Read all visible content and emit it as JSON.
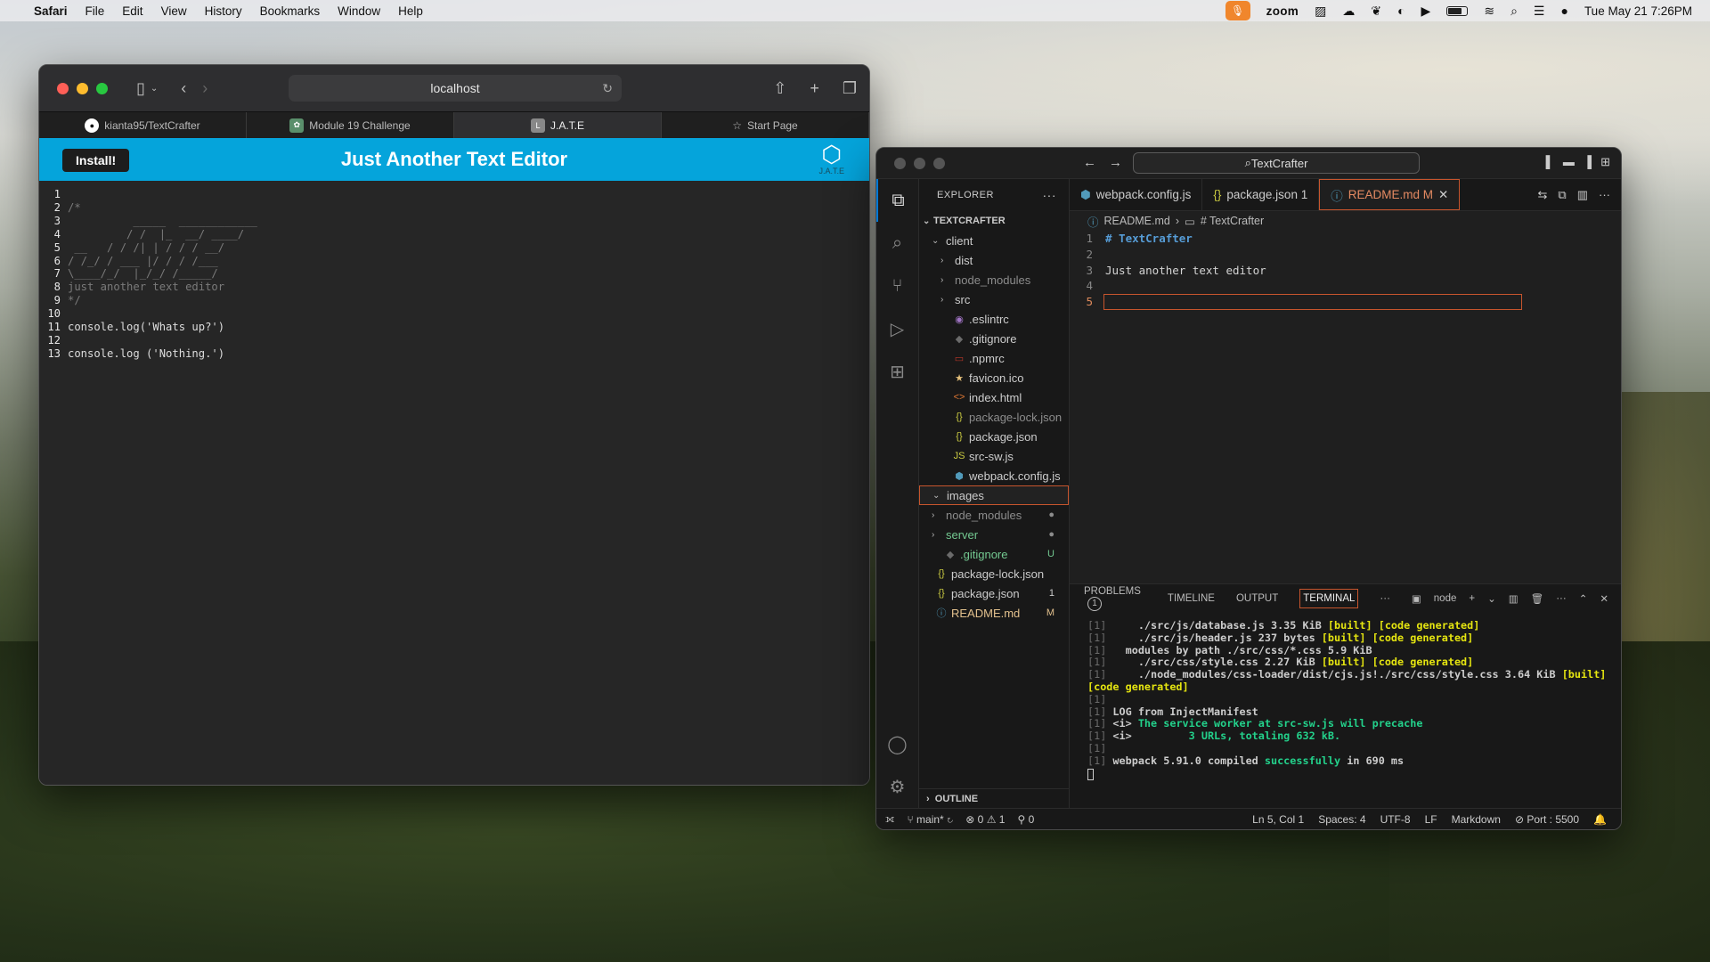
{
  "menubar": {
    "items": [
      "Safari",
      "File",
      "Edit",
      "View",
      "History",
      "Bookmarks",
      "Window",
      "Help"
    ],
    "zoom": "zoom",
    "datetime": "Tue May 21  7:26PM"
  },
  "safari": {
    "url": "localhost",
    "tabs": [
      {
        "label": "kianta95/TextCrafter",
        "icon": "github-icon"
      },
      {
        "label": "Module 19 Challenge",
        "icon": "page-icon"
      },
      {
        "label": "J.A.T.E",
        "icon": "letter-l-icon"
      },
      {
        "label": "Start Page",
        "icon": "star-icon"
      }
    ],
    "active_tab": 2
  },
  "jate": {
    "install_label": "Install!",
    "title": "Just Another Text Editor",
    "logo_text": "J.A.T.E",
    "lines": [
      {
        "n": "1",
        "text": "",
        "cls": "code"
      },
      {
        "n": "2",
        "text": "/*",
        "cls": "cm"
      },
      {
        "n": "3",
        "text": "          _____  ____________ ",
        "cls": "cm"
      },
      {
        "n": "4",
        "text": "         / /  |_  __/ ____/",
        "cls": "cm"
      },
      {
        "n": "5",
        "text": " __   / / /| | / / / __/   ",
        "cls": "cm"
      },
      {
        "n": "6",
        "text": "/ /_/ / ___ |/ / / /___   ",
        "cls": "cm"
      },
      {
        "n": "7",
        "text": "\\____/_/  |_/_/ /_____/   ",
        "cls": "cm"
      },
      {
        "n": "8",
        "text": "just another text editor",
        "cls": "cm"
      },
      {
        "n": "9",
        "text": "*/",
        "cls": "cm"
      },
      {
        "n": "10",
        "text": "",
        "cls": "code"
      },
      {
        "n": "11",
        "text": "console.log('Whats up?')",
        "cls": "code"
      },
      {
        "n": "12",
        "text": "",
        "cls": "code"
      },
      {
        "n": "13",
        "text": "console.log ('Nothing.')",
        "cls": "code"
      }
    ]
  },
  "vscode": {
    "search": "TextCrafter",
    "explorer_title": "EXPLORER",
    "root": "TEXTCRAFTER",
    "tree": [
      {
        "label": "client",
        "indent": 1,
        "chev": "v",
        "icon": "",
        "color": "#cccccc",
        "badge": ""
      },
      {
        "label": "dist",
        "indent": 2,
        "chev": ">",
        "icon": "",
        "color": "#cccccc",
        "badge": ""
      },
      {
        "label": "node_modules",
        "indent": 2,
        "chev": ">",
        "icon": "",
        "color": "#8c8c8c",
        "badge": ""
      },
      {
        "label": "src",
        "indent": 2,
        "chev": ">",
        "icon": "",
        "color": "#cccccc",
        "badge": ""
      },
      {
        "label": ".eslintrc",
        "indent": 2,
        "chev": "",
        "icon": "◉",
        "iconColor": "#a074c4",
        "color": "#cccccc",
        "badge": ""
      },
      {
        "label": ".gitignore",
        "indent": 2,
        "chev": "",
        "icon": "◆",
        "iconColor": "#6b6b6b",
        "color": "#cccccc",
        "badge": ""
      },
      {
        "label": ".npmrc",
        "indent": 2,
        "chev": "",
        "icon": "▭",
        "iconColor": "#c0392b",
        "color": "#cccccc",
        "badge": ""
      },
      {
        "label": "favicon.ico",
        "indent": 2,
        "chev": "",
        "icon": "★",
        "iconColor": "#e5c07b",
        "color": "#cccccc",
        "badge": ""
      },
      {
        "label": "index.html",
        "indent": 2,
        "chev": "",
        "icon": "<>",
        "iconColor": "#e37933",
        "color": "#cccccc",
        "badge": ""
      },
      {
        "label": "package-lock.json",
        "indent": 2,
        "chev": "",
        "icon": "{}",
        "iconColor": "#cbcb41",
        "color": "#8c8c8c",
        "badge": ""
      },
      {
        "label": "package.json",
        "indent": 2,
        "chev": "",
        "icon": "{}",
        "iconColor": "#cbcb41",
        "color": "#cccccc",
        "badge": ""
      },
      {
        "label": "src-sw.js",
        "indent": 2,
        "chev": "",
        "icon": "JS",
        "iconColor": "#cbcb41",
        "color": "#cccccc",
        "badge": ""
      },
      {
        "label": "webpack.config.js",
        "indent": 2,
        "chev": "",
        "icon": "⬢",
        "iconColor": "#519aba",
        "color": "#cccccc",
        "badge": ""
      },
      {
        "label": "images",
        "indent": 1,
        "chev": "v",
        "icon": "",
        "color": "#cccccc",
        "badge": "",
        "selected": true
      },
      {
        "label": "node_modules",
        "indent": 1,
        "chev": ">",
        "icon": "",
        "color": "#8c8c8c",
        "badge": "●"
      },
      {
        "label": "server",
        "indent": 1,
        "chev": ">",
        "icon": "",
        "color": "#73c991",
        "badge": "●"
      },
      {
        "label": ".gitignore",
        "indent": 1,
        "chev": "",
        "icon": "◆",
        "iconColor": "#6b6b6b",
        "color": "#73c991",
        "badge": "U"
      },
      {
        "label": "package-lock.json",
        "indent": 0,
        "chev": "",
        "icon": "{}",
        "iconColor": "#cbcb41",
        "color": "#cccccc",
        "badge": ""
      },
      {
        "label": "package.json",
        "indent": 0,
        "chev": "",
        "icon": "{}",
        "iconColor": "#cbcb41",
        "color": "#cccccc",
        "badge": "1"
      },
      {
        "label": "README.md",
        "indent": 0,
        "chev": "",
        "icon": "ⓘ",
        "iconColor": "#519aba",
        "color": "#e2c08d",
        "badge": "M"
      }
    ],
    "outline_label": "OUTLINE",
    "tabs": [
      {
        "label": "webpack.config.js",
        "icon": "⬢",
        "iconColor": "#519aba"
      },
      {
        "label": "package.json 1",
        "icon": "{}",
        "iconColor": "#cbcb41"
      },
      {
        "label": "README.md M",
        "icon": "ⓘ",
        "iconColor": "#519aba",
        "active": true
      }
    ],
    "breadcrumb": {
      "file": "README.md",
      "section": "# TextCrafter"
    },
    "code": [
      {
        "n": "1",
        "text": "# TextCrafter",
        "heading": true
      },
      {
        "n": "2",
        "text": ""
      },
      {
        "n": "3",
        "text": "Just another text editor"
      },
      {
        "n": "4",
        "text": ""
      },
      {
        "n": "5",
        "text": "",
        "current": true
      }
    ],
    "panel_tabs": [
      "PROBLEMS",
      "TIMELINE",
      "OUTPUT",
      "TERMINAL"
    ],
    "problems_count": "1",
    "terminal_shell": "node",
    "terminal": [
      [
        {
          "t": "[1]",
          "c": "t1"
        },
        {
          "t": "     ./src/js/database.js 3.35 KiB ",
          "c": ""
        },
        {
          "t": "[built] [code generated]",
          "c": "ty"
        }
      ],
      [
        {
          "t": "[1]",
          "c": "t1"
        },
        {
          "t": "     ./src/js/header.js 237 bytes ",
          "c": ""
        },
        {
          "t": "[built] [code generated]",
          "c": "ty"
        }
      ],
      [
        {
          "t": "[1]",
          "c": "t1"
        },
        {
          "t": "   modules by path ./src/css/*.css 5.9 KiB",
          "c": ""
        }
      ],
      [
        {
          "t": "[1]",
          "c": "t1"
        },
        {
          "t": "     ./src/css/style.css 2.27 KiB ",
          "c": ""
        },
        {
          "t": "[built] [code generated]",
          "c": "ty"
        }
      ],
      [
        {
          "t": "[1]",
          "c": "t1"
        },
        {
          "t": "     ./node_modules/css-loader/dist/cjs.js!./src/css/style.css 3.64 KiB ",
          "c": ""
        },
        {
          "t": "[built]",
          "c": "ty"
        }
      ],
      [
        {
          "t": "[code generated]",
          "c": "ty"
        }
      ],
      [
        {
          "t": "[1]",
          "c": "t1"
        }
      ],
      [
        {
          "t": "[1]",
          "c": "t1"
        },
        {
          "t": " LOG from InjectManifest",
          "c": ""
        }
      ],
      [
        {
          "t": "[1]",
          "c": "t1"
        },
        {
          "t": " <i> ",
          "c": ""
        },
        {
          "t": "The service worker at src-sw.js will precache",
          "c": "tg"
        }
      ],
      [
        {
          "t": "[1]",
          "c": "t1"
        },
        {
          "t": " <i> ",
          "c": ""
        },
        {
          "t": "        3 URLs, totaling 632 kB.",
          "c": "tg"
        }
      ],
      [
        {
          "t": "[1]",
          "c": "t1"
        }
      ],
      [
        {
          "t": "[1]",
          "c": "t1"
        },
        {
          "t": " webpack 5.91.0 compiled ",
          "c": ""
        },
        {
          "t": "successfully",
          "c": "tg"
        },
        {
          "t": " in 690 ms",
          "c": ""
        }
      ]
    ],
    "status": {
      "branch": "main*",
      "errors": "0",
      "warnings": "1",
      "ports": "0",
      "position": "Ln 5, Col 1",
      "spaces": "Spaces: 4",
      "encoding": "UTF-8",
      "eol": "LF",
      "language": "Markdown",
      "port": "Port : 5500"
    }
  }
}
